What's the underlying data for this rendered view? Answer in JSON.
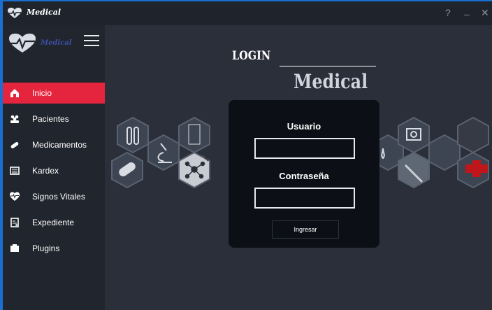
{
  "window": {
    "title": "Medical",
    "help_label": "?",
    "minimize_label": "_",
    "close_label": "✕"
  },
  "sidebar": {
    "brand": "Medical",
    "items": [
      {
        "label": "Inicio",
        "icon": "home-icon",
        "active": true
      },
      {
        "label": "Pacientes",
        "icon": "patients-icon",
        "active": false
      },
      {
        "label": "Medicamentos",
        "icon": "pill-icon",
        "active": false
      },
      {
        "label": "Kardex",
        "icon": "kardex-icon",
        "active": false
      },
      {
        "label": "Signos Vitales",
        "icon": "heartbeat-icon",
        "active": false
      },
      {
        "label": "Expediente",
        "icon": "record-icon",
        "active": false
      },
      {
        "label": "Plugins",
        "icon": "plugins-icon",
        "active": false
      }
    ]
  },
  "main": {
    "login_heading": "LOGIN",
    "brand_heading": "Medical",
    "form": {
      "user_label": "Usuario",
      "user_value": "",
      "password_label": "Contraseña",
      "password_value": "",
      "submit_label": "Ingresar"
    }
  },
  "colors": {
    "accent": "#e5253d",
    "frame": "#1a6fd0",
    "sidebar": "#21252d",
    "panel": "#0c1016",
    "background": "#2b2f39"
  }
}
